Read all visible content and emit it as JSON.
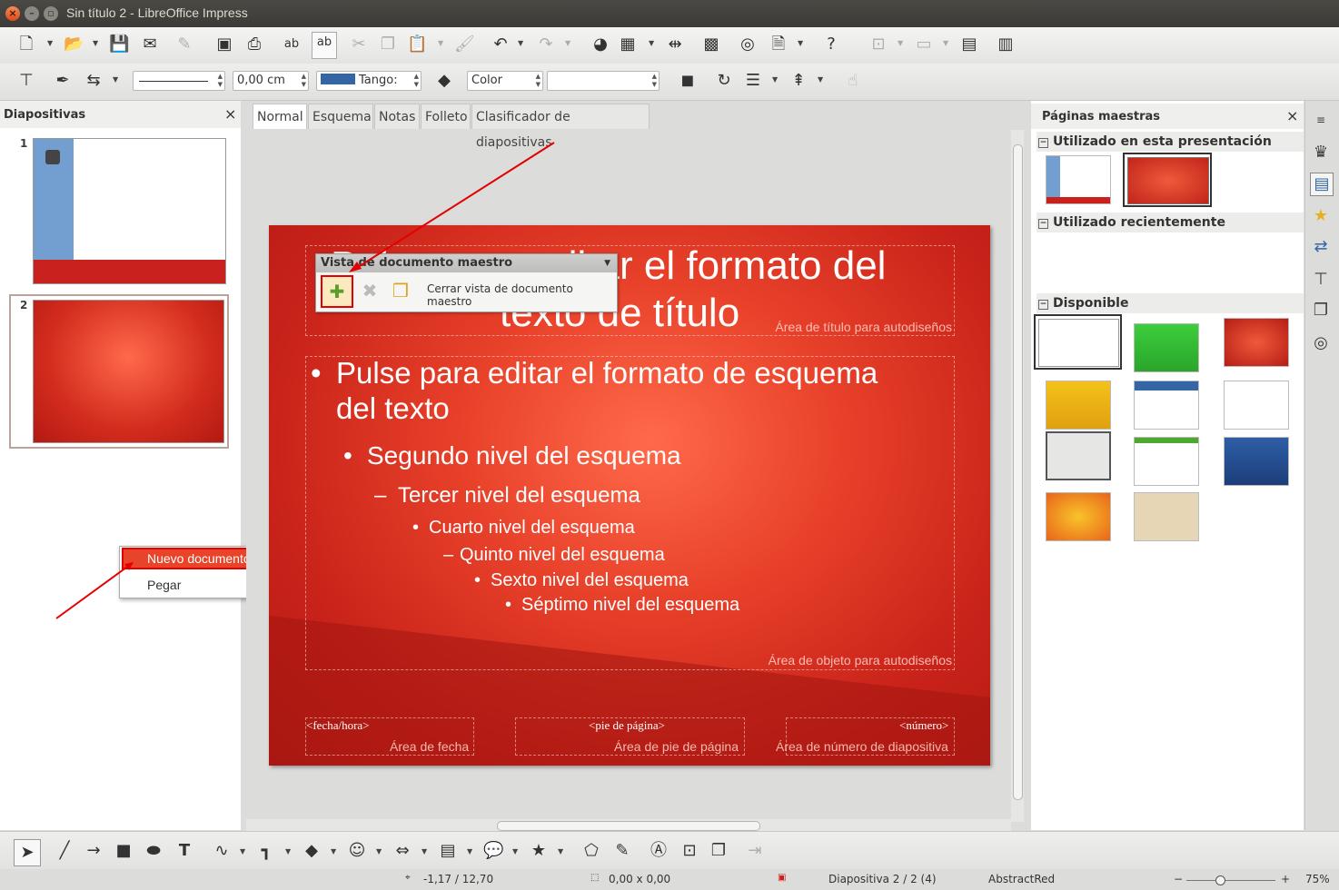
{
  "window": {
    "title": "Sin título 2 - LibreOffice Impress"
  },
  "format_toolbar": {
    "line_width_value": "0,00 cm",
    "fill_color_label": "Tango:",
    "area_style_value": "Color",
    "area_fill_value": ""
  },
  "slides_panel": {
    "title": "Diapositivas",
    "close": "×",
    "slides": [
      {
        "number": "1"
      },
      {
        "number": "2"
      }
    ]
  },
  "view_tabs": [
    "Normal",
    "Esquema",
    "Notas",
    "Folleto",
    "Clasificador de diapositivas"
  ],
  "slide": {
    "title_line1": "Pulse para editar el formato del",
    "title_line2": "texto de título",
    "title_area_label": "Área de título para autodiseños",
    "outline": [
      {
        "bullet": "•",
        "text": "Pulse para editar el formato de esquema"
      },
      {
        "bullet": "",
        "text": "del texto"
      },
      {
        "bullet": "•",
        "text": "Segundo nivel del esquema"
      },
      {
        "bullet": "–",
        "text": "Tercer nivel del esquema"
      },
      {
        "bullet": "•",
        "text": "Cuarto nivel del esquema"
      },
      {
        "bullet": "–",
        "text": "Quinto nivel del esquema"
      },
      {
        "bullet": "•",
        "text": "Sexto nivel del esquema"
      },
      {
        "bullet": "•",
        "text": "Séptimo nivel del esquema"
      }
    ],
    "object_area_label": "Área de objeto para autodiseños",
    "date_field": "<fecha/hora>",
    "date_area_label": "Área de fecha",
    "footer_field": "<pie de página>",
    "footer_area_label": "Área de pie de página",
    "number_field": "<número>",
    "number_area_label": "Área de número de diapositiva"
  },
  "master_view_toolbar": {
    "title": "Vista de documento maestro",
    "close_label": "Cerrar vista de documento maestro"
  },
  "context_menu": {
    "items": [
      "Nuevo documento maestro",
      "Pegar"
    ]
  },
  "master_pages_panel": {
    "title": "Páginas maestras",
    "close": "×",
    "section_used": "Utilizado en esta presentación",
    "section_recent": "Utilizado recientemente",
    "section_available": "Disponible"
  },
  "status_bar": {
    "position": "-1,17 / 12,70",
    "size": "0,00 x 0,00",
    "slide_info": "Diapositiva 2 / 2 (4)",
    "master_name": "AbstractRed",
    "zoom": "75%"
  },
  "colors": {
    "accent_red": "#e30000",
    "slide_red": "#c9231a",
    "fill_blue": "#3465a4"
  }
}
